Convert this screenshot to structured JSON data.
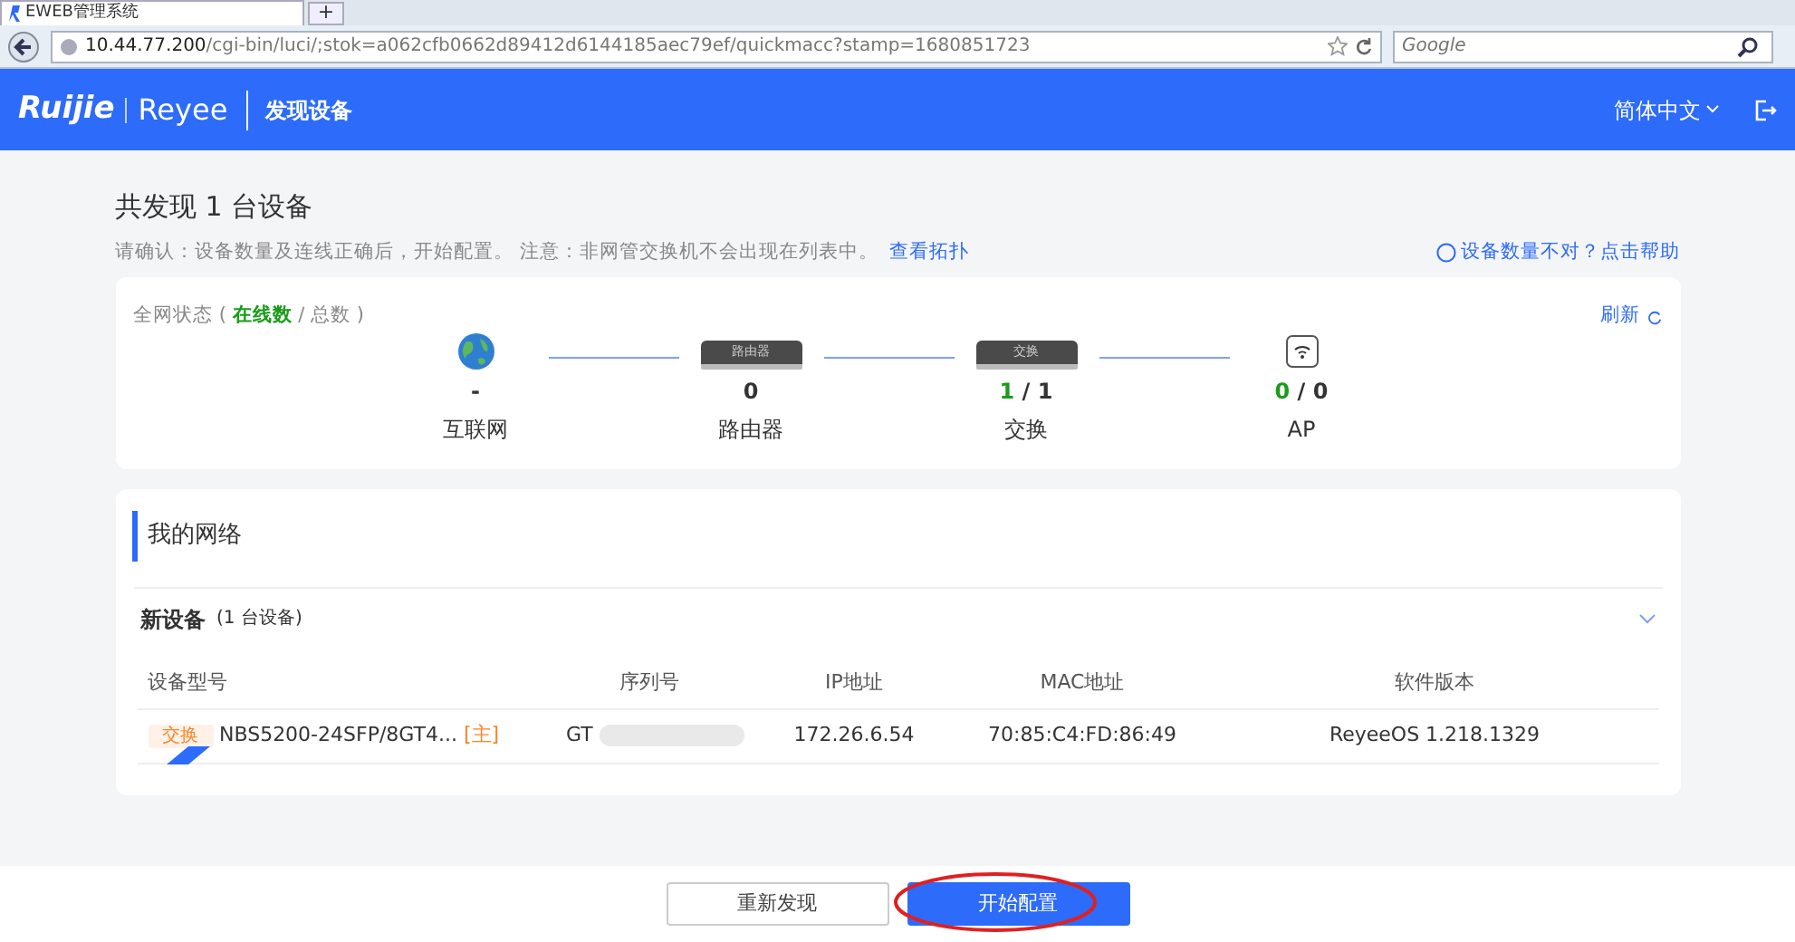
{
  "browser": {
    "tab_title": "EWEB管理系统",
    "new_tab": "+",
    "url_host": "10.44.77.200",
    "url_path": "/cgi-bin/luci/;stok=a062cfb0662d89412d6144185aec79ef/quickmacc?stamp=1680851723",
    "search_placeholder": "Google"
  },
  "header": {
    "brand": "Ruijie",
    "sub_brand": "Reyee",
    "title": "发现设备",
    "language": "简体中文"
  },
  "summary": {
    "heading": "共发现 1 台设备",
    "note": "请确认：设备数量及连线正确后，开始配置。 注意：非网管交换机不会出现在列表中。",
    "topology_link": "查看拓扑",
    "help_link": "设备数量不对？点击帮助"
  },
  "status": {
    "label": "全网状态 (",
    "online_label": "在线数",
    "total_label": "/ 总数 )",
    "refresh": "刷新",
    "nodes": [
      {
        "kind": "internet",
        "label": "互联网",
        "count": "-"
      },
      {
        "kind": "router",
        "box_label": "路由器",
        "label": "路由器",
        "count": "0"
      },
      {
        "kind": "switch",
        "box_label": "交换",
        "label": "交换",
        "online": "1",
        "total": "/ 1"
      },
      {
        "kind": "ap",
        "label": "AP",
        "online": "0",
        "total": "/ 0"
      }
    ]
  },
  "network": {
    "title": "我的网络",
    "group": "新设备",
    "group_count": "(1 台设备)",
    "expanded": true,
    "columns": [
      "设备型号",
      "序列号",
      "IP地址",
      "MAC地址",
      "软件版本"
    ],
    "rows": [
      {
        "type_tag": "交换",
        "model": "NBS5200-24SFP/8GT4...",
        "master": "[主]",
        "serial": "GT",
        "ip": "172.26.6.54",
        "mac": "70:85:C4:FD:86:49",
        "version": "ReyeeOS 1.218.1329"
      }
    ]
  },
  "footer": {
    "buttons": [
      {
        "label": "重新发现",
        "kind": "secondary",
        "highlighted": false
      },
      {
        "label": "开始配置",
        "kind": "primary",
        "highlighted": true
      }
    ]
  }
}
